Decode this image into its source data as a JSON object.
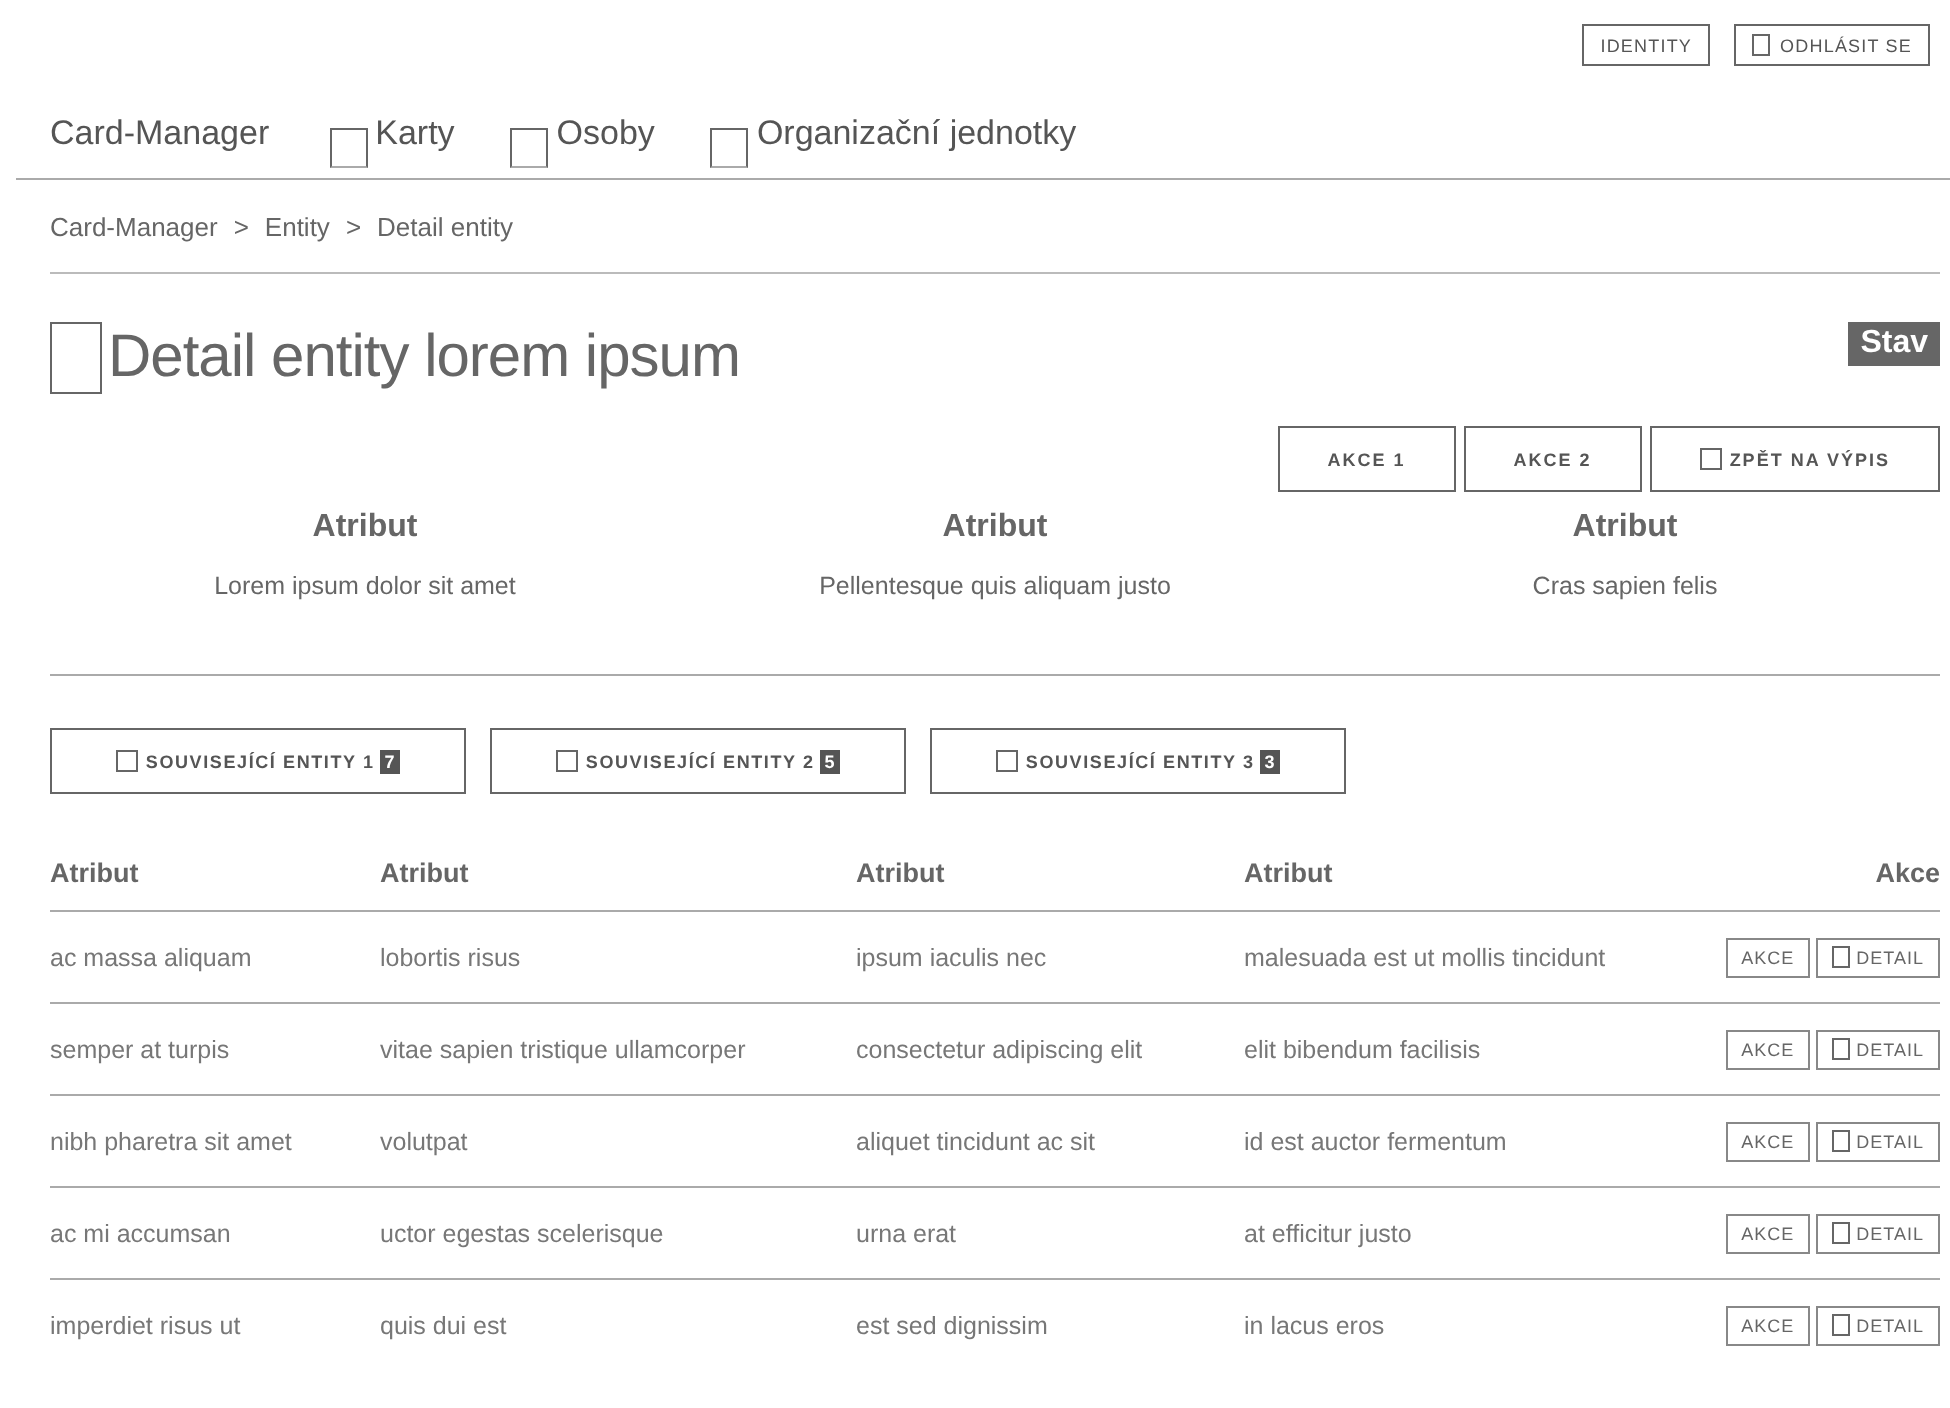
{
  "top_buttons": [
    {
      "label": "IDENTITY",
      "icon": false
    },
    {
      "label": "ODHLÁSIT SE",
      "icon": true
    }
  ],
  "nav": {
    "brand": "Card-Manager",
    "items": [
      "Karty",
      "Osoby",
      "Organizační jednotky"
    ]
  },
  "breadcrumb": [
    "Card-Manager",
    "Entity",
    "Detail entity"
  ],
  "breadcrumb_separator": ">",
  "title": "Detail entity lorem ipsum",
  "status_badge": "Stav",
  "actions": [
    {
      "label": "AKCE 1",
      "icon": false
    },
    {
      "label": "AKCE 2",
      "icon": false
    },
    {
      "label": "ZPĚT NA VÝPIS",
      "icon": true
    }
  ],
  "attributes": [
    {
      "label": "Atribut",
      "value": "Lorem ipsum dolor sit amet"
    },
    {
      "label": "Atribut",
      "value": "Pellentesque quis aliquam justo"
    },
    {
      "label": "Atribut",
      "value": "Cras sapien felis"
    }
  ],
  "tabs": [
    {
      "label": "SOUVISEJÍCÍ ENTITY 1",
      "count": "7"
    },
    {
      "label": "SOUVISEJÍCÍ ENTITY 2",
      "count": "5"
    },
    {
      "label": "SOUVISEJÍCÍ ENTITY 3",
      "count": "3"
    }
  ],
  "table": {
    "columns": [
      "Atribut",
      "Atribut",
      "Atribut",
      "Atribut",
      "Akce"
    ],
    "rows": [
      {
        "cells": [
          "ac massa aliquam",
          "lobortis risus",
          "ipsum iaculis nec",
          "malesuada est ut mollis tincidunt"
        ],
        "actions": [
          "AKCE",
          "DETAIL"
        ]
      },
      {
        "cells": [
          "semper at turpis",
          "vitae sapien tristique ullamcorper",
          "consectetur adipiscing elit",
          "elit bibendum facilisis"
        ],
        "actions": [
          "AKCE",
          "DETAIL"
        ]
      },
      {
        "cells": [
          "nibh pharetra sit amet",
          "volutpat",
          "aliquet tincidunt ac sit",
          "id est auctor fermentum"
        ],
        "actions": [
          "AKCE",
          "DETAIL"
        ]
      },
      {
        "cells": [
          "ac mi accumsan",
          "uctor egestas scelerisque",
          "urna erat",
          "at efficitur justo"
        ],
        "actions": [
          "AKCE",
          "DETAIL"
        ]
      },
      {
        "cells": [
          "imperdiet risus ut",
          "quis dui est",
          "est sed dignissim",
          "in lacus eros"
        ],
        "actions": [
          "AKCE",
          "DETAIL"
        ]
      }
    ]
  }
}
